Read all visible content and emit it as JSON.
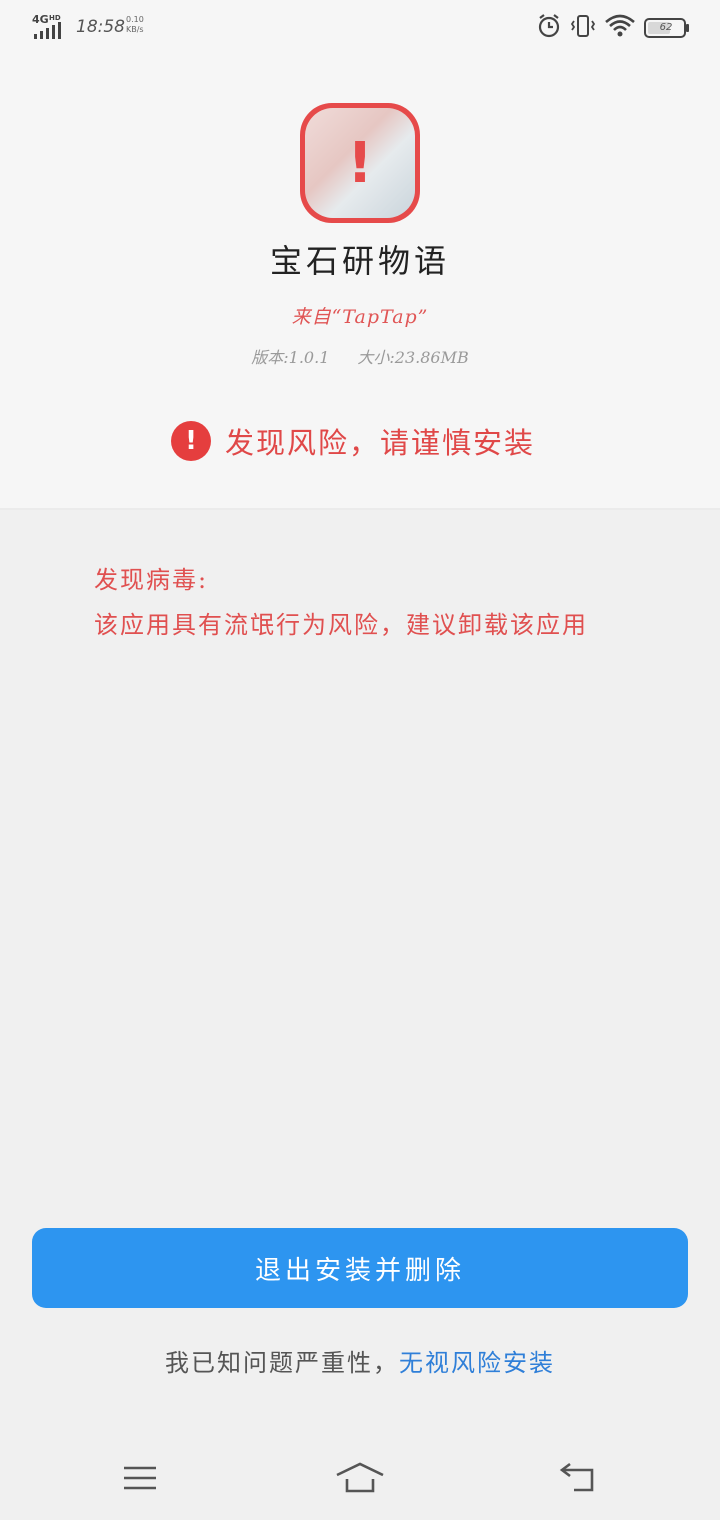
{
  "status_bar": {
    "network": "4G",
    "network_sub": "HD",
    "time": "18:58",
    "speed_value": "0.10",
    "speed_unit": "KB/s",
    "battery": "62",
    "icons": [
      "alarm-icon",
      "vibrate-icon",
      "wifi-icon",
      "battery-icon"
    ]
  },
  "app": {
    "name": "宝石研物语",
    "source": "来自“TapTap”",
    "version": "版本:1.0.1",
    "size": "大小:23.86MB",
    "icon": "app-icon-with-warning"
  },
  "warning": {
    "icon": "exclamation-icon",
    "text": "发现风险，请谨慎安装"
  },
  "virus": {
    "title": "发现病毒:",
    "description": "该应用具有流氓行为风险，建议卸载该应用"
  },
  "actions": {
    "primary_label": "退出安装并删除",
    "ack_text": "我已知问题严重性，",
    "ack_link": "无视风险安装"
  },
  "nav": {
    "items": [
      "menu-icon",
      "home-icon",
      "back-icon"
    ]
  },
  "colors": {
    "danger": "#e53e3e",
    "primary": "#2d95f0",
    "link": "#2f7fd8"
  }
}
